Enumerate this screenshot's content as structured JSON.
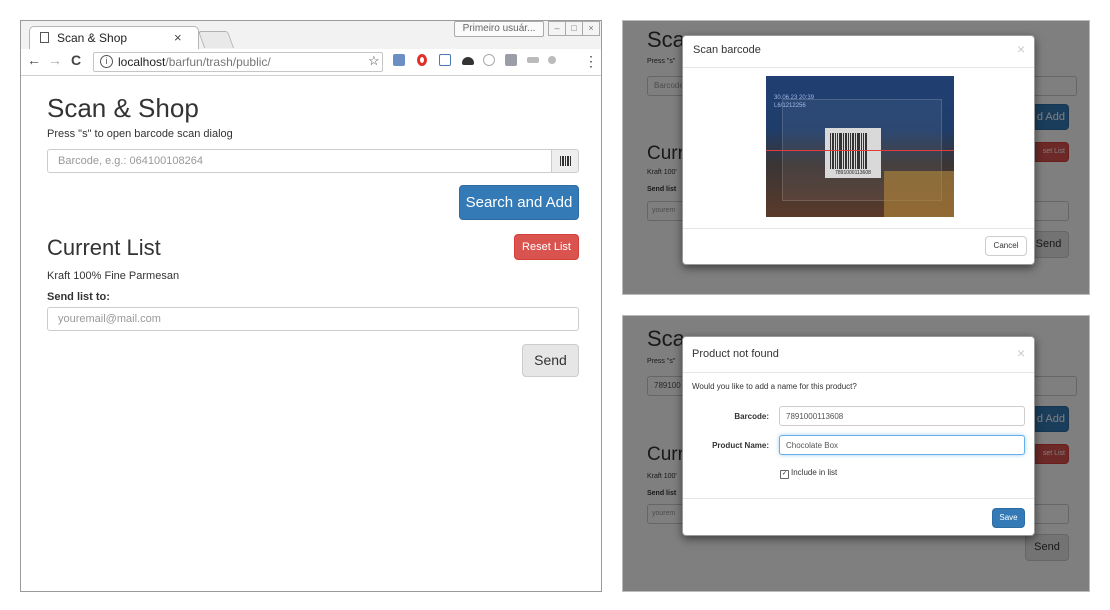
{
  "browser": {
    "tab_title": "Scan & Shop",
    "tab_close": "×",
    "profile_label": "Primeiro usuár...",
    "url_host": "localhost",
    "url_path": "/barfun/trash/public/",
    "nav_back": "←",
    "nav_forward": "→",
    "nav_reload": "C",
    "star": "☆",
    "menu": "⋮"
  },
  "app": {
    "title": "Scan & Shop",
    "hint": "Press \"s\" to open barcode scan dialog",
    "barcode_placeholder": "Barcode, e.g.: 064100108264",
    "search_add_label": "Search and Add",
    "list_title": "Current List",
    "reset_label": "Reset List",
    "items": [
      "Kraft 100% Fine Parmesan"
    ],
    "send_to_label": "Send list to:",
    "email_placeholder": "youremail@mail.com",
    "send_label": "Send"
  },
  "scan_panel": {
    "bg_title": "Sca",
    "bg_hint": "Press \"s\"",
    "bg_input": "Barcode",
    "bg_add": "d Add",
    "bg_list": "Curr",
    "bg_item": "Kraft 100'",
    "bg_send_to": "Send list",
    "bg_email": "yourem",
    "bg_reset": "set List",
    "bg_send": "Send",
    "modal_title": "Scan barcode",
    "close": "×",
    "cancel_label": "Cancel",
    "overlay_text": "30.06.23 20:39 L6/1212256",
    "barcode_digits": "7891000113608"
  },
  "notfound_panel": {
    "bg_title": "Sca",
    "bg_hint": "Press \"s\"",
    "bg_input": "789100",
    "bg_add": "d Add",
    "bg_list": "Curr",
    "bg_item": "Kraft 100'",
    "bg_send_to": "Send list",
    "bg_email": "yourem",
    "bg_reset": "set List",
    "bg_send": "Send",
    "modal_title": "Product not found",
    "close": "×",
    "question": "Would you like to add a name for this product?",
    "barcode_label": "Barcode:",
    "barcode_value": "7891000113608",
    "name_label": "Product Name:",
    "name_value": "Chocolate Box",
    "include_label": "Include in list",
    "save_label": "Save"
  },
  "colors": {
    "primary": "#337ab7",
    "danger": "#d9534f",
    "default": "#e6e6e6"
  }
}
